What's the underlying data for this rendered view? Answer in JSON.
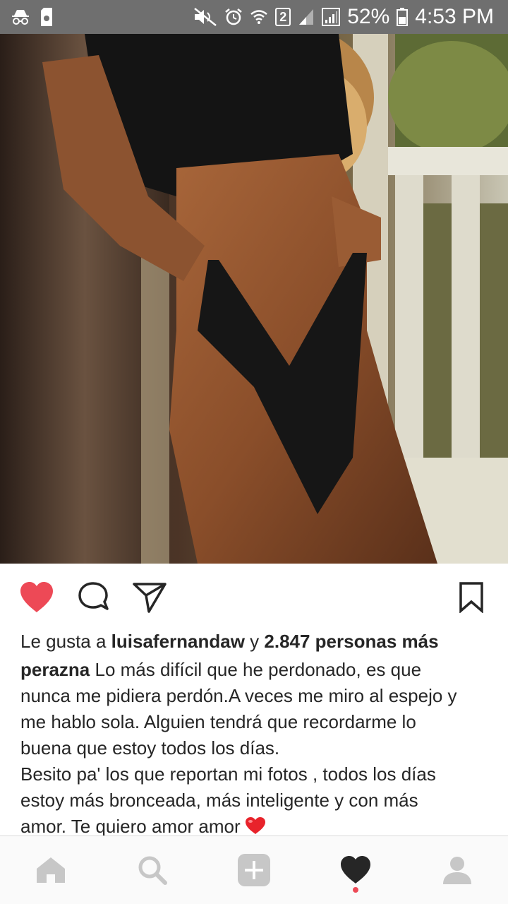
{
  "status_bar": {
    "icons_left": [
      "incognito-icon",
      "storage-icon"
    ],
    "icons_right": [
      "mute-icon",
      "alarm-icon",
      "wifi-icon",
      "sim2-icon",
      "signal-icon",
      "signal-icon"
    ],
    "sim_label": "2",
    "battery": "52%",
    "time": "4:53 PM"
  },
  "post": {
    "photo_icon": "post-photo"
  },
  "actions": {
    "liked": true,
    "like_color": "#ed4956"
  },
  "likes": {
    "prefix": "Le gusta a ",
    "user": "luisafernandaw",
    "connector": " y ",
    "others": "2.847 personas más"
  },
  "caption": {
    "username": "perazna",
    "lines": [
      " Lo más difícil que he perdonado, es que",
      "nunca me pidiera perdón.A veces me miro al espejo y",
      "me hablo sola. Alguien tendrá que recordarme lo",
      "buena que estoy todos los días.",
      "Besito pa' los que reportan mi fotos , todos los días",
      "estoy más bronceada, más inteligente y con más",
      "amor. Te quiero amor amor"
    ],
    "emoji": "red-heart-emoji"
  },
  "bottom_nav": {
    "items": [
      "home-icon",
      "search-icon",
      "add-icon",
      "activity-heart-icon",
      "profile-icon"
    ],
    "active": "activity-heart-icon"
  }
}
